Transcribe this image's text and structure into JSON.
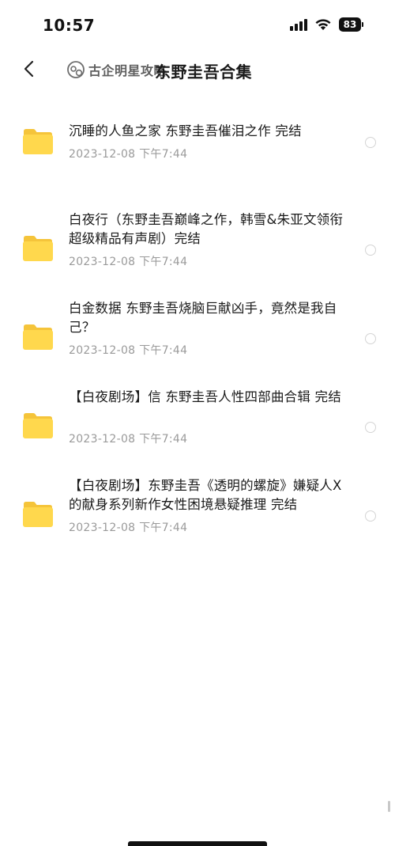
{
  "status_bar": {
    "time": "10:57",
    "battery": "83"
  },
  "header": {
    "watermark": "古企明星攻略",
    "title": "东野圭吾合集"
  },
  "colors": {
    "folder": "#FFD84D",
    "folder_tab": "#F5C43A",
    "date": "#9a9a9a",
    "radio_border": "#d4d4d4"
  },
  "files": [
    {
      "name": "沉睡的人鱼之家  东野圭吾催泪之作  完结",
      "date": "2023-12-08 下午7:44"
    },
    {
      "name": "白夜行（东野圭吾巅峰之作，韩雪&朱亚文领衔超级精品有声剧）完结",
      "date": "2023-12-08 下午7:44"
    },
    {
      "name": "白金数据  东野圭吾烧脑巨献凶手，竟然是我自己？",
      "date": "2023-12-08 下午7:44"
    },
    {
      "name": "【白夜剧场】信  东野圭吾人性四部曲合辑  完结",
      "date": "2023-12-08 下午7:44"
    },
    {
      "name": "【白夜剧场】东野圭吾《透明的螺旋》嫌疑人X的献身系列新作女性困境悬疑推理  完结",
      "date": "2023-12-08 下午7:44"
    }
  ]
}
